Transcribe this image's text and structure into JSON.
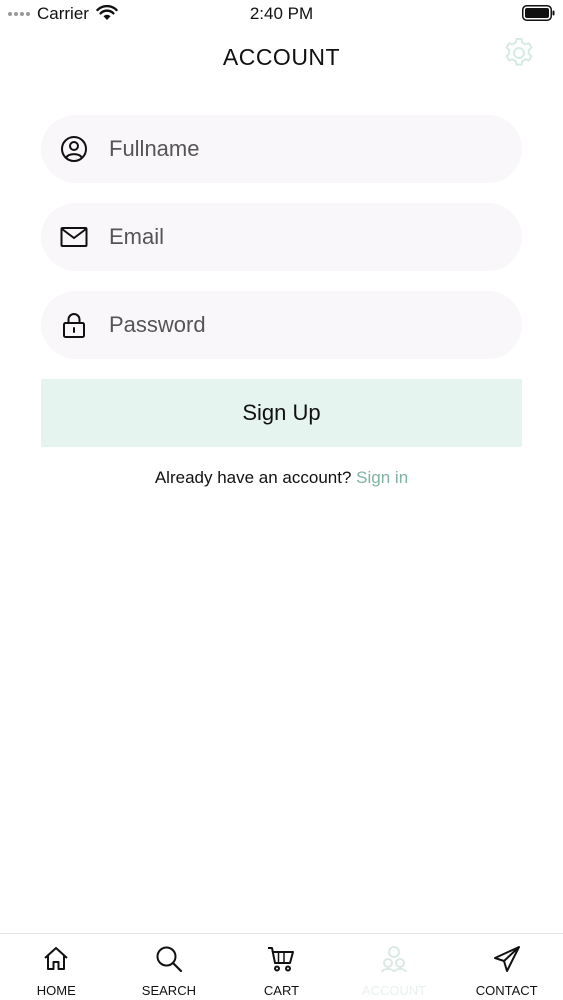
{
  "status_bar": {
    "carrier": "Carrier",
    "time": "2:40 PM"
  },
  "header": {
    "title": "ACCOUNT"
  },
  "form": {
    "fullname_placeholder": "Fullname",
    "email_placeholder": "Email",
    "password_placeholder": "Password",
    "signup_label": "Sign Up",
    "signin_prompt": "Already have an account?",
    "signin_link": "Sign in"
  },
  "tabbar": {
    "items": [
      {
        "label": "HOME",
        "icon": "home-icon"
      },
      {
        "label": "SEARCH",
        "icon": "search-icon"
      },
      {
        "label": "CART",
        "icon": "cart-icon"
      },
      {
        "label": "ACCOUNT",
        "icon": "account-icon",
        "active": true
      },
      {
        "label": "CONTACT",
        "icon": "send-icon"
      }
    ]
  },
  "colors": {
    "accent": "#7fb3a0",
    "button_bg": "#e6f4ef",
    "field_bg": "#faf7fb",
    "inactive_icon": "#dbe9e4"
  }
}
